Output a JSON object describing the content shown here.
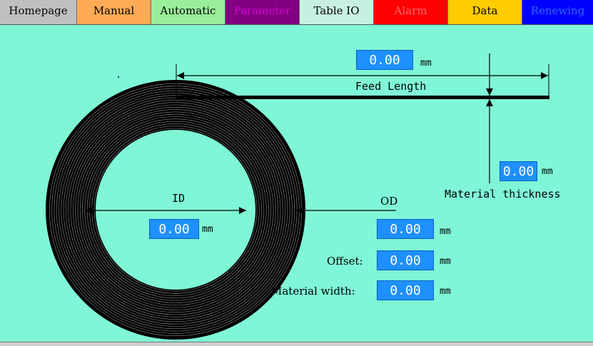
{
  "tabs": [
    {
      "label": "Homepage",
      "bg": "#c0c0c0",
      "fg": "#000000"
    },
    {
      "label": "Manual",
      "bg": "#ffaa55",
      "fg": "#000000"
    },
    {
      "label": "Automatic",
      "bg": "#99ee99",
      "fg": "#000000"
    },
    {
      "label": "Parameter",
      "bg": "#800080",
      "fg": "#d000d0"
    },
    {
      "label": "Table IO",
      "bg": "#c8f0e0",
      "fg": "#000000"
    },
    {
      "label": "Alarm",
      "bg": "#ff0000",
      "fg": "#ff6666"
    },
    {
      "label": "Data",
      "bg": "#ffcc00",
      "fg": "#000000"
    },
    {
      "label": "Renewing",
      "bg": "#0000ff",
      "fg": "#3366ff"
    }
  ],
  "feed_length": {
    "value": "0.00",
    "unit": "mm",
    "label": "Feed Length"
  },
  "material_thickness": {
    "value": "0.00",
    "unit": "mm",
    "label": "Material thickness"
  },
  "inner_diameter": {
    "value": "0.00",
    "unit": "mm",
    "label": "ID"
  },
  "outer_diameter": {
    "value": "0.00",
    "unit": "mm",
    "label": "OD"
  },
  "offset": {
    "value": "0.00",
    "unit": "mm",
    "label": "Offset:"
  },
  "material_width": {
    "value": "0.00",
    "unit": "mm",
    "label": "Material width:"
  }
}
